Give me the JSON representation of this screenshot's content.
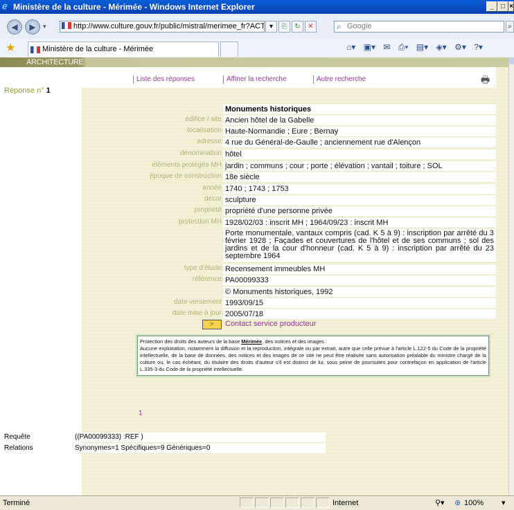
{
  "window": {
    "title": "Ministère de la culture - Mérimée - Windows Internet Explorer",
    "controls": [
      "_",
      "□",
      "×"
    ]
  },
  "address": {
    "url": "http://www.culture.gouv.fr/public/mistral/merimee_fr?ACTION",
    "search_placeholder": "Google"
  },
  "tab": {
    "label": "Ministère de la culture - Mérimée"
  },
  "page": {
    "section": "ARCHITECTURE",
    "nav": [
      "Liste des réponses",
      "Affiner la recherche",
      "Autre recherche"
    ],
    "reponse_label": "Réponse n°",
    "reponse_num": "1",
    "heading": "Monuments historiques",
    "fields": [
      {
        "label": "édifice / site",
        "value": "Ancien hôtel de la Gabelle"
      },
      {
        "label": "localisation",
        "value": "Haute-Normandie ; Eure ; Bernay"
      },
      {
        "label": "adresse",
        "value": "4 rue du Général-de-Gaulle ; anciennement rue d'Alençon"
      },
      {
        "label": "dénomination",
        "value": "hôtel"
      },
      {
        "label": "éléments protégés MH",
        "value": "jardin ; communs ; cour ; porte ; élévation ; vantail ; toiture ; SOL"
      },
      {
        "label": "époque de construction",
        "value": "18e siècle"
      },
      {
        "label": "année",
        "value": "1740 ; 1743 ; 1753"
      },
      {
        "label": "décor",
        "value": "sculpture"
      },
      {
        "label": "propriété",
        "value": "propriété d'une personne privée"
      },
      {
        "label": "protection MH",
        "value": "1928/02/03 : inscrit MH ; 1964/09/23 : inscrit MH"
      },
      {
        "label": "",
        "value": "Porte monumentale, vantaux compris (cad. K 5 à 9) : inscription par arrêté du 3 février 1928 ; Façades et couvertures de l'hôtel et de ses communs ; sol des jardins et de la cour d'honneur (cad. K 5 à 9) : inscription par arrêté du 23 septembre 1964"
      },
      {
        "label": "type d'étude",
        "value": "Recensement immeubles MH"
      },
      {
        "label": "référence",
        "value": "PA00099333"
      },
      {
        "label": "",
        "value": "© Monuments historiques, 1992"
      },
      {
        "label": "date versement",
        "value": "1993/09/15"
      },
      {
        "label": "date mise à jour",
        "value": "2005/07/18"
      }
    ],
    "contact": "Contact service producteur",
    "notice_title_pre": "Protection des droits des auteurs de la base ",
    "notice_title_link": "Mérimée",
    "notice_title_post": ", des notices et des images :",
    "notice_body": "Aucune exploitation, notamment la diffusion et la reproduction, intégrale ou par extrait, autre que celle prévue à l'article L.122-5 du Code de la propriété intellectuelle, de la base de données, des notices et des images de ce site ne peut être réalisée sans autorisation préalable du ministre chargé de la culture ou, le cas échéant, du titulaire des droits d'auteur s'il est distinct de lui, sous peine de poursuites pour contrefaçon en application de l'article L.335-3 du Code de la propriété intellectuelle.",
    "page_number": "1",
    "requete_label": "Requête",
    "requete_value": "((PA00099333) :REF )",
    "relations_label": "Relations",
    "relations_value": "Synonymes=1 Spécifiques=9 Génériques=0"
  },
  "status": {
    "text": "Terminé",
    "zone": "Internet",
    "zoom": "100%"
  }
}
